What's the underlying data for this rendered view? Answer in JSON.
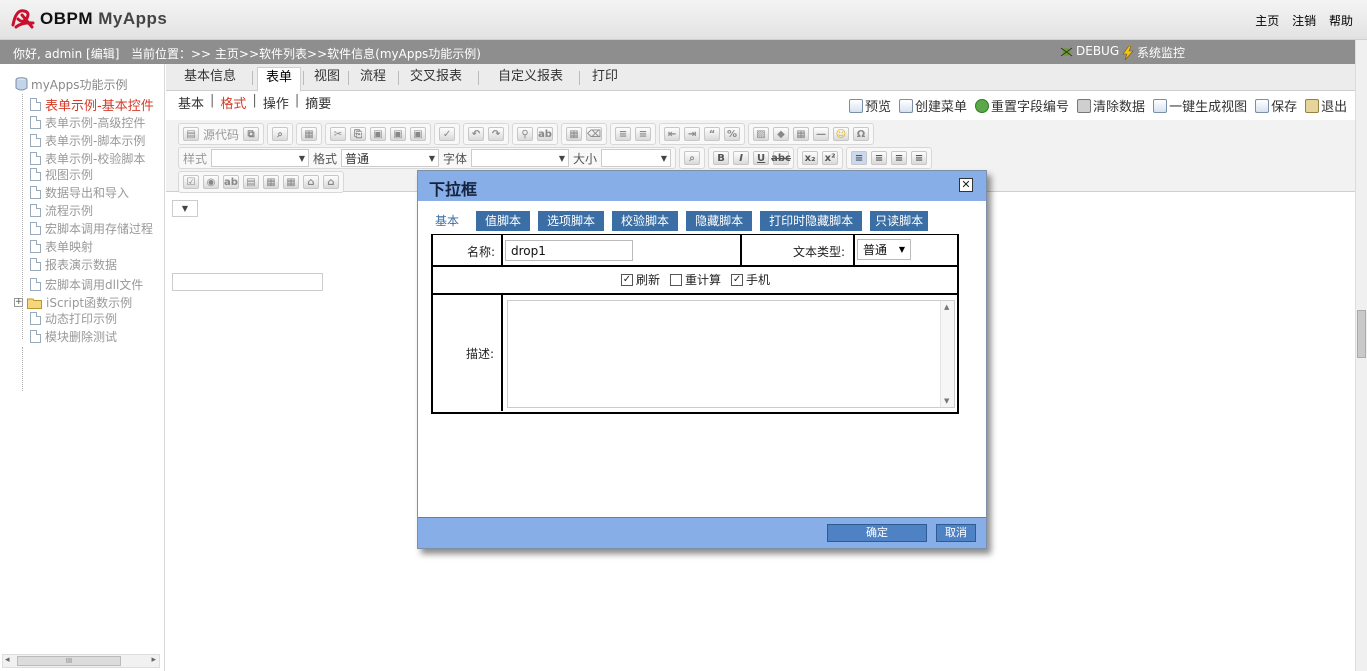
{
  "app": {
    "logo_text": "OBPM",
    "logo_sub": "MyApps",
    "top_links": [
      "主页",
      "注销",
      "帮助"
    ]
  },
  "statusbar": {
    "greeting": "你好, admin [编辑]",
    "location": "当前位置：>> 主页>>软件列表>>软件信息(myApps功能示例)",
    "debug": "DEBUG",
    "monitor": "系统监控"
  },
  "sidebar": {
    "root": "myApps功能示例",
    "items": [
      "表单示例-基本控件",
      "表单示例-高级控件",
      "表单示例-脚本示例",
      "表单示例-校验脚本",
      "视图示例",
      "数据导出和导入",
      "流程示例",
      "宏脚本调用存储过程",
      "表单映射",
      "报表演示数据",
      "宏脚本调用dll文件",
      "iScript函数示例",
      "动态打印示例",
      "模块删除测试"
    ],
    "scroll_label": "III"
  },
  "main_tabs": [
    "基本信息",
    "表单",
    "视图",
    "流程",
    "交叉报表",
    "自定义报表",
    "打印"
  ],
  "sub_tabs": [
    "基本",
    "格式",
    "操作",
    "摘要"
  ],
  "actions": [
    "预览",
    "创建菜单",
    "重置字段编号",
    "清除数据",
    "一键生成视图",
    "保存",
    "退出"
  ],
  "toolbar": {
    "source": "源代码",
    "style_label": "样式",
    "format_label": "格式",
    "format_value": "普通",
    "font_label": "字体",
    "size_label": "大小"
  },
  "dialog": {
    "title": "下拉框",
    "tabs": [
      "基本",
      "值脚本",
      "选项脚本",
      "校验脚本",
      "隐藏脚本",
      "打印时隐藏脚本",
      "只读脚本"
    ],
    "name_label": "名称:",
    "name_value": "drop1",
    "type_label": "文本类型:",
    "type_value": "普通",
    "checkboxes": [
      {
        "label": "刷新",
        "checked": true
      },
      {
        "label": "重计算",
        "checked": false
      },
      {
        "label": "手机",
        "checked": true
      }
    ],
    "desc_label": "描述:",
    "ok": "确定",
    "cancel": "取消"
  },
  "colors": {
    "dialog_header": "#87aee6",
    "tab_blue": "#3a6ea5",
    "active_red": "#d43c2a",
    "statusbar": "#8e8e8e"
  }
}
